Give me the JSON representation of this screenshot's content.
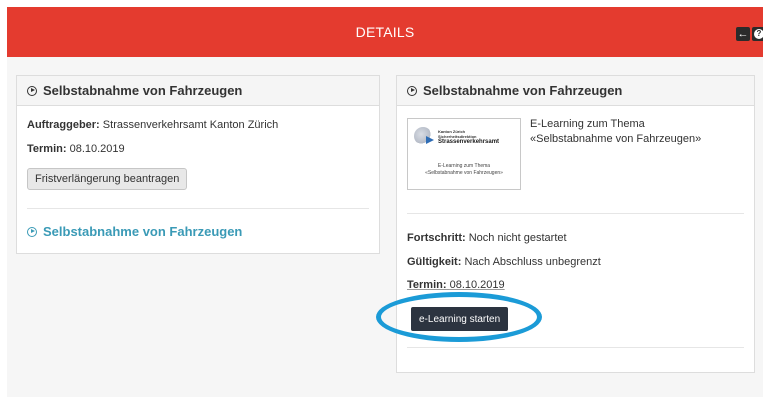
{
  "header": {
    "title": "DETAILS",
    "back_icon": "arrow-left-icon",
    "help_icon": "question-circle-icon",
    "color": "#e43b2f"
  },
  "left_panel": {
    "title": "Selbstabnahme von Fahrzeugen",
    "auftraggeber_label": "Auftraggeber:",
    "auftraggeber_value": "Strassenverkehrsamt Kanton Zürich",
    "termin_label": "Termin:",
    "termin_value": "08.10.2019",
    "extend_button": "Fristverlängerung beantragen",
    "link_text": "Selbstabnahme von Fahrzeugen"
  },
  "right_panel": {
    "title": "Selbstabnahme von Fahrzeugen",
    "thumbnail": {
      "logo_line1": "Kanton Zürich",
      "logo_line2": "Sicherheitsdirektion",
      "logo_line3": "Strassenverkehrsamt",
      "caption_line1": "E-Learning zum Thema",
      "caption_line2": "«Selbstabnahme von Fahrzeugen»"
    },
    "description_line1": "E-Learning zum Thema",
    "description_line2": "«Selbstabnahme von Fahrzeugen»",
    "progress_label": "Fortschritt:",
    "progress_value": "Noch nicht gestartet",
    "validity_label": "Gültigkeit:",
    "validity_value": "Nach Abschluss unbegrenzt",
    "termin_label": "Termin:",
    "termin_value": "08.10.2019",
    "start_button": "e-Learning starten"
  },
  "highlight_color": "#1b9bd7"
}
